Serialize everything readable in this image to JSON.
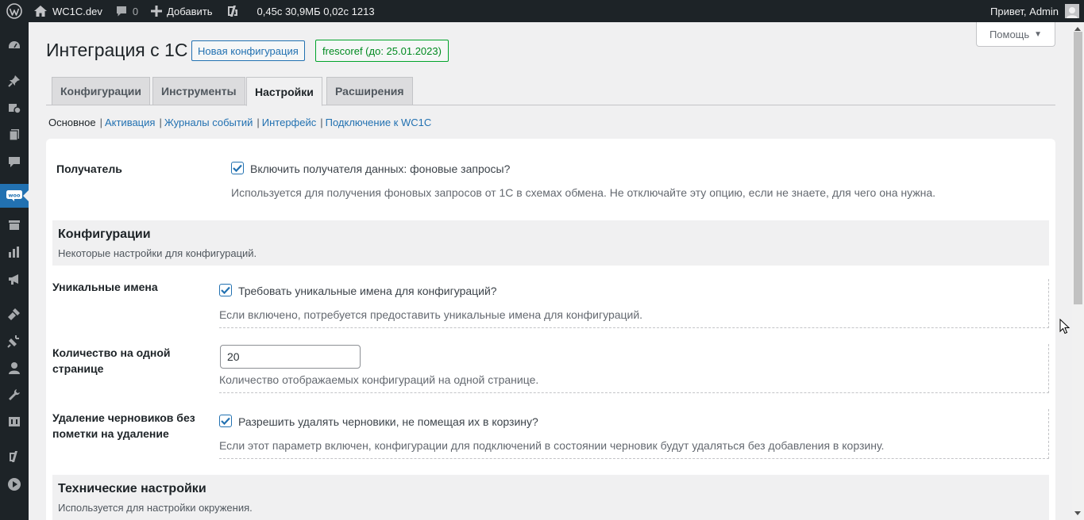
{
  "adminbar": {
    "site_name": "WC1C.dev",
    "comments_count": "0",
    "add_new": "Добавить",
    "metrics": "0,45с 30,9МБ 0,02с 1213",
    "greeting": "Привет, Admin"
  },
  "help": {
    "label": "Помощь",
    "caret": "▼"
  },
  "page": {
    "title": "Интеграция с 1С",
    "new_config_button": "Новая конфигурация",
    "license_badge": "frescoref (до: 25.01.2023)"
  },
  "tabs": [
    {
      "label": "Конфигурации"
    },
    {
      "label": "Инструменты"
    },
    {
      "label": "Настройки"
    },
    {
      "label": "Расширения"
    }
  ],
  "active_tab": "Настройки",
  "subnav": {
    "current": "Основное",
    "links": [
      "Активация",
      "Журналы событий",
      "Интерфейс",
      "Подключение к WC1C"
    ],
    "separator": "|"
  },
  "settings": {
    "receiver": {
      "label": "Получатель",
      "checkbox_label": "Включить получателя данных: фоновые запросы?",
      "checked": true,
      "description": "Используется для получения фоновых запросов от 1С в схемах обмена. Не отключайте эту опцию, если не знаете, для чего она нужна."
    },
    "configurations_section": {
      "title": "Конфигурации",
      "subtitle": "Некоторые настройки для конфигураций."
    },
    "unique_names": {
      "label": "Уникальные имена",
      "checkbox_label": "Требовать уникальные имена для конфигураций?",
      "checked": true,
      "description": "Если включено, потребуется предоставить уникальные имена для конфигураций."
    },
    "per_page": {
      "label_line1": "Количество на одной",
      "label_line2": "странице",
      "value": "20",
      "description": "Количество отображаемых конфигураций на одной странице."
    },
    "delete_drafts": {
      "label_line1": "Удаление черновиков без",
      "label_line2": "пометки на удаление",
      "checkbox_label": "Разрешить удалять черновики, не помещая их в корзину?",
      "checked": true,
      "description": "Если этот параметр включен, конфигурации для подключений в состоянии черновик будут удаляться без добавления в корзину."
    },
    "technical_section": {
      "title": "Технические настройки",
      "subtitle": "Используется для настройки окружения."
    }
  },
  "colors": {
    "admin_dark": "#1d2327",
    "accent": "#2271b1",
    "success": "#00a32a"
  }
}
